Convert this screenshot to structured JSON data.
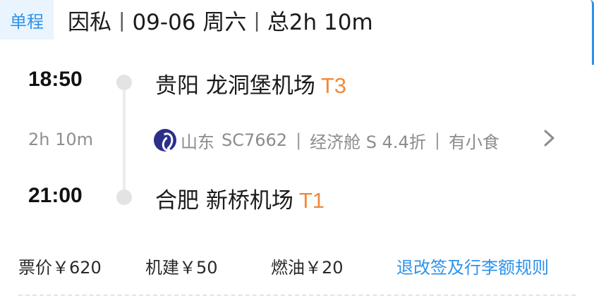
{
  "header": {
    "trip_type": "单程",
    "purpose": "因私",
    "date": "09-06 周六",
    "total_duration": "总2h 10m",
    "separator": "|"
  },
  "departure": {
    "time": "18:50",
    "airport": "贵阳 龙洞堡机场",
    "terminal": "T3"
  },
  "duration": "2h 10m",
  "flight": {
    "airline_logo_icon": "shandong-airlines-logo-icon",
    "airline": "山东",
    "flight_no": "SC7662",
    "cabin": "经济舱 S 4.4折",
    "meal": "有小食",
    "separator": "|",
    "detail_icon": "chevron-right-icon"
  },
  "arrival": {
    "time": "21:00",
    "airport": "合肥 新桥机场",
    "terminal": "T1"
  },
  "prices": {
    "fare": "票价￥620",
    "airport_fee": "机建￥50",
    "fuel_fee": "燃油￥20",
    "rules_link": "退改签及行李额规则"
  },
  "colors": {
    "accent": "#2c92ea",
    "terminal": "#f08a3c",
    "muted": "#8c8c8c"
  }
}
